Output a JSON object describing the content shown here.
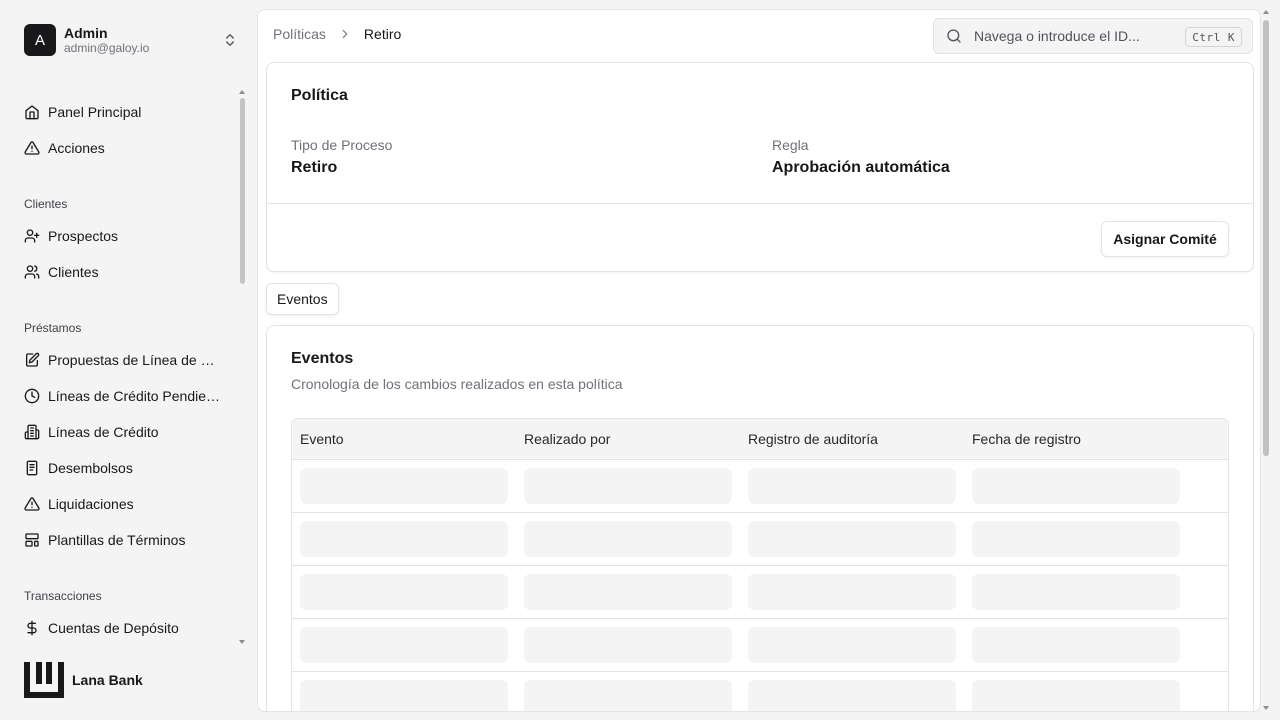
{
  "user": {
    "initial": "A",
    "name": "Admin",
    "email": "admin@galoy.io"
  },
  "nav": {
    "primary": [
      {
        "label": "Panel Principal",
        "icon": "home-icon"
      },
      {
        "label": "Acciones",
        "icon": "alert-triangle-icon"
      }
    ],
    "groups": [
      {
        "title": "Clientes",
        "items": [
          {
            "label": "Prospectos",
            "icon": "user-plus-icon"
          },
          {
            "label": "Clientes",
            "icon": "users-icon"
          }
        ]
      },
      {
        "title": "Préstamos",
        "items": [
          {
            "label": "Propuestas de Línea de Crédito",
            "icon": "file-edit-icon"
          },
          {
            "label": "Líneas de Crédito Pendientes",
            "icon": "clock-icon"
          },
          {
            "label": "Líneas de Crédito",
            "icon": "building-icon"
          },
          {
            "label": "Desembolsos",
            "icon": "receipt-icon"
          },
          {
            "label": "Liquidaciones",
            "icon": "alert-triangle-icon"
          },
          {
            "label": "Plantillas de Términos",
            "icon": "layout-template-icon"
          }
        ]
      },
      {
        "title": "Transacciones",
        "items": [
          {
            "label": "Cuentas de Depósito",
            "icon": "dollar-icon"
          }
        ]
      }
    ]
  },
  "brand": {
    "name": "Lana Bank"
  },
  "breadcrumb": {
    "parent": "Políticas",
    "current": "Retiro"
  },
  "search": {
    "placeholder": "Navega o introduce el ID...",
    "shortcut": "Ctrl K"
  },
  "policy": {
    "title": "Política",
    "process_type_label": "Tipo de Proceso",
    "process_type_value": "Retiro",
    "rule_label": "Regla",
    "rule_value": "Aprobación automática",
    "assign_button": "Asignar Comité"
  },
  "tabs": [
    {
      "label": "Eventos",
      "active": true
    }
  ],
  "events": {
    "title": "Eventos",
    "subtitle": "Cronología de los cambios realizados en esta política",
    "columns": [
      "Evento",
      "Realizado por",
      "Registro de auditoría",
      "Fecha de registro"
    ],
    "loading_rows": 5
  },
  "colors": {
    "background": "#f4f4f5",
    "surface": "#ffffff",
    "border": "#e4e4e7",
    "text": "#18181b",
    "muted": "#71717a",
    "skeleton": "#f4f4f5"
  }
}
